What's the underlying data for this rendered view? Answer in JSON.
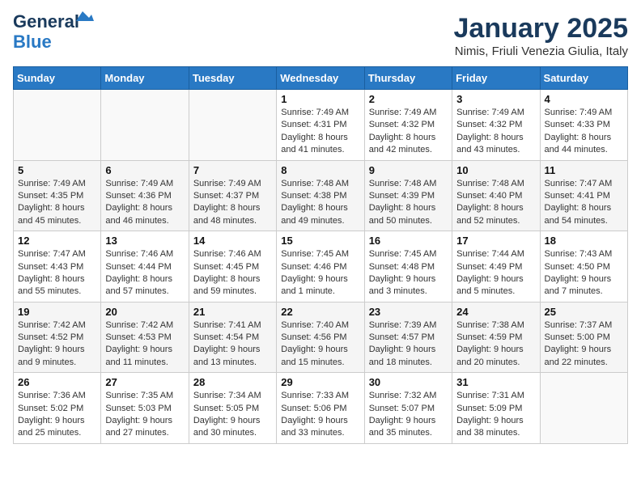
{
  "header": {
    "logo_general": "General",
    "logo_blue": "Blue",
    "month_title": "January 2025",
    "location": "Nimis, Friuli Venezia Giulia, Italy"
  },
  "weekdays": [
    "Sunday",
    "Monday",
    "Tuesday",
    "Wednesday",
    "Thursday",
    "Friday",
    "Saturday"
  ],
  "weeks": [
    [
      {
        "day": "",
        "info": ""
      },
      {
        "day": "",
        "info": ""
      },
      {
        "day": "",
        "info": ""
      },
      {
        "day": "1",
        "info": "Sunrise: 7:49 AM\nSunset: 4:31 PM\nDaylight: 8 hours and 41 minutes."
      },
      {
        "day": "2",
        "info": "Sunrise: 7:49 AM\nSunset: 4:32 PM\nDaylight: 8 hours and 42 minutes."
      },
      {
        "day": "3",
        "info": "Sunrise: 7:49 AM\nSunset: 4:32 PM\nDaylight: 8 hours and 43 minutes."
      },
      {
        "day": "4",
        "info": "Sunrise: 7:49 AM\nSunset: 4:33 PM\nDaylight: 8 hours and 44 minutes."
      }
    ],
    [
      {
        "day": "5",
        "info": "Sunrise: 7:49 AM\nSunset: 4:35 PM\nDaylight: 8 hours and 45 minutes."
      },
      {
        "day": "6",
        "info": "Sunrise: 7:49 AM\nSunset: 4:36 PM\nDaylight: 8 hours and 46 minutes."
      },
      {
        "day": "7",
        "info": "Sunrise: 7:49 AM\nSunset: 4:37 PM\nDaylight: 8 hours and 48 minutes."
      },
      {
        "day": "8",
        "info": "Sunrise: 7:48 AM\nSunset: 4:38 PM\nDaylight: 8 hours and 49 minutes."
      },
      {
        "day": "9",
        "info": "Sunrise: 7:48 AM\nSunset: 4:39 PM\nDaylight: 8 hours and 50 minutes."
      },
      {
        "day": "10",
        "info": "Sunrise: 7:48 AM\nSunset: 4:40 PM\nDaylight: 8 hours and 52 minutes."
      },
      {
        "day": "11",
        "info": "Sunrise: 7:47 AM\nSunset: 4:41 PM\nDaylight: 8 hours and 54 minutes."
      }
    ],
    [
      {
        "day": "12",
        "info": "Sunrise: 7:47 AM\nSunset: 4:43 PM\nDaylight: 8 hours and 55 minutes."
      },
      {
        "day": "13",
        "info": "Sunrise: 7:46 AM\nSunset: 4:44 PM\nDaylight: 8 hours and 57 minutes."
      },
      {
        "day": "14",
        "info": "Sunrise: 7:46 AM\nSunset: 4:45 PM\nDaylight: 8 hours and 59 minutes."
      },
      {
        "day": "15",
        "info": "Sunrise: 7:45 AM\nSunset: 4:46 PM\nDaylight: 9 hours and 1 minute."
      },
      {
        "day": "16",
        "info": "Sunrise: 7:45 AM\nSunset: 4:48 PM\nDaylight: 9 hours and 3 minutes."
      },
      {
        "day": "17",
        "info": "Sunrise: 7:44 AM\nSunset: 4:49 PM\nDaylight: 9 hours and 5 minutes."
      },
      {
        "day": "18",
        "info": "Sunrise: 7:43 AM\nSunset: 4:50 PM\nDaylight: 9 hours and 7 minutes."
      }
    ],
    [
      {
        "day": "19",
        "info": "Sunrise: 7:42 AM\nSunset: 4:52 PM\nDaylight: 9 hours and 9 minutes."
      },
      {
        "day": "20",
        "info": "Sunrise: 7:42 AM\nSunset: 4:53 PM\nDaylight: 9 hours and 11 minutes."
      },
      {
        "day": "21",
        "info": "Sunrise: 7:41 AM\nSunset: 4:54 PM\nDaylight: 9 hours and 13 minutes."
      },
      {
        "day": "22",
        "info": "Sunrise: 7:40 AM\nSunset: 4:56 PM\nDaylight: 9 hours and 15 minutes."
      },
      {
        "day": "23",
        "info": "Sunrise: 7:39 AM\nSunset: 4:57 PM\nDaylight: 9 hours and 18 minutes."
      },
      {
        "day": "24",
        "info": "Sunrise: 7:38 AM\nSunset: 4:59 PM\nDaylight: 9 hours and 20 minutes."
      },
      {
        "day": "25",
        "info": "Sunrise: 7:37 AM\nSunset: 5:00 PM\nDaylight: 9 hours and 22 minutes."
      }
    ],
    [
      {
        "day": "26",
        "info": "Sunrise: 7:36 AM\nSunset: 5:02 PM\nDaylight: 9 hours and 25 minutes."
      },
      {
        "day": "27",
        "info": "Sunrise: 7:35 AM\nSunset: 5:03 PM\nDaylight: 9 hours and 27 minutes."
      },
      {
        "day": "28",
        "info": "Sunrise: 7:34 AM\nSunset: 5:05 PM\nDaylight: 9 hours and 30 minutes."
      },
      {
        "day": "29",
        "info": "Sunrise: 7:33 AM\nSunset: 5:06 PM\nDaylight: 9 hours and 33 minutes."
      },
      {
        "day": "30",
        "info": "Sunrise: 7:32 AM\nSunset: 5:07 PM\nDaylight: 9 hours and 35 minutes."
      },
      {
        "day": "31",
        "info": "Sunrise: 7:31 AM\nSunset: 5:09 PM\nDaylight: 9 hours and 38 minutes."
      },
      {
        "day": "",
        "info": ""
      }
    ]
  ]
}
